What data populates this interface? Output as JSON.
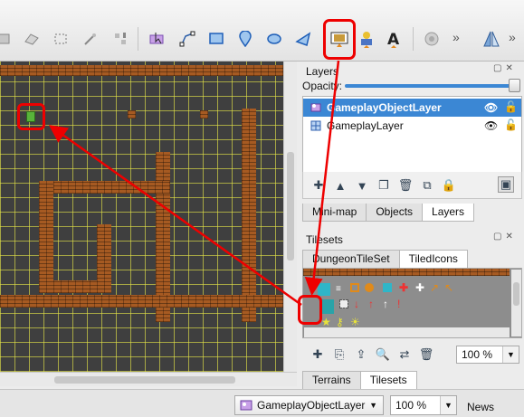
{
  "toolbar": {
    "icons": [
      "stamp-brush-icon",
      "eraser-icon",
      "rectangle-select-icon",
      "magic-wand-icon",
      "select-same-tile-icon",
      "select-objects-icon",
      "edit-polygons-icon",
      "insert-rectangle-icon",
      "insert-point-icon",
      "insert-ellipse-icon",
      "insert-polygon-icon",
      "insert-tile-icon",
      "insert-template-icon",
      "insert-text-icon",
      "world-tool-icon",
      "flip-icon"
    ],
    "more_label": "»"
  },
  "layers_panel": {
    "title": "Layers",
    "opacity_label": "Opacity:",
    "opacity": 1.0,
    "layers": [
      {
        "name": "GameplayObjectLayer",
        "type": "object",
        "selected": true
      },
      {
        "name": "GameplayLayer",
        "type": "tile",
        "selected": false
      }
    ],
    "tabs": [
      "Mini-map",
      "Objects",
      "Layers"
    ],
    "active_tab": "Layers"
  },
  "tilesets_panel": {
    "title": "Tilesets",
    "tabs": [
      "DungeonTileSet",
      "TiledIcons"
    ],
    "active_tab": "TiledIcons",
    "zoom": "100 %"
  },
  "bottom_tabs": {
    "tabs": [
      "Terrains",
      "Tilesets"
    ],
    "active_tab": "Tilesets"
  },
  "statusbar": {
    "current_layer": "GameplayObjectLayer",
    "zoom": "100 %",
    "news_label": "News"
  },
  "colors": {
    "highlight": "#ee0000",
    "selection": "#3b87d4",
    "map_background": "#3f3f3f",
    "wall": "#a65a22",
    "grid": "#e1e146"
  }
}
